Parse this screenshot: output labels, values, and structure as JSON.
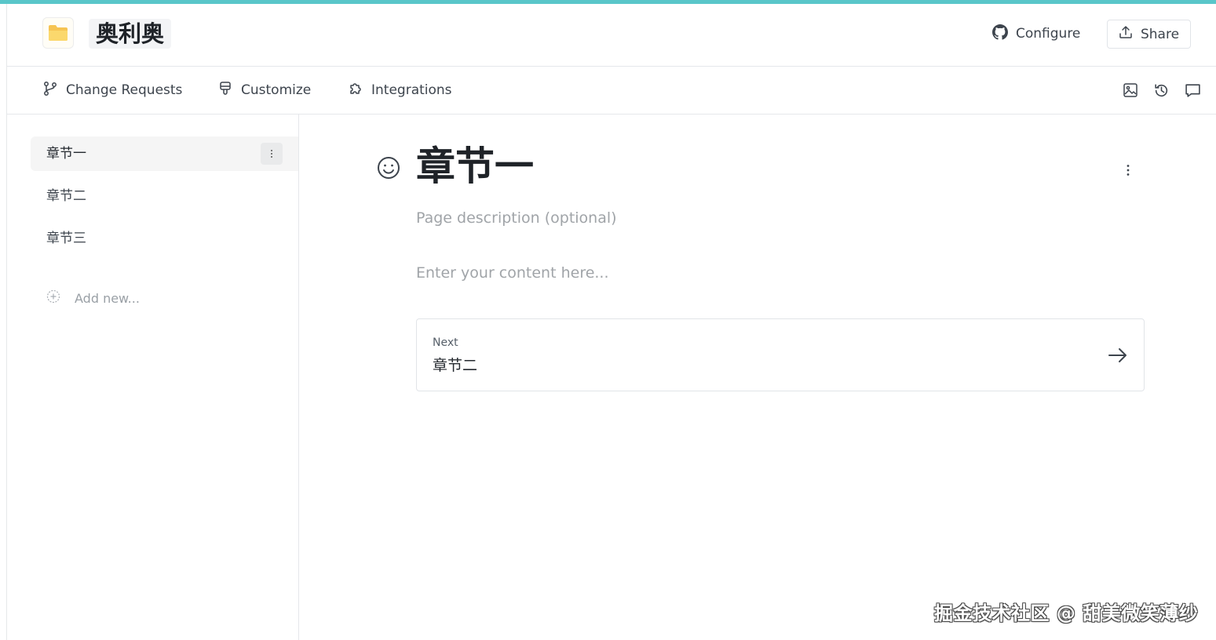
{
  "header": {
    "space_icon": "folder-icon",
    "space_title": "奥利奥",
    "configure_label": "Configure",
    "configure_icon": "github-icon",
    "share_label": "Share",
    "share_icon": "upload-icon"
  },
  "toolbar": {
    "tabs": [
      {
        "label": "Change Requests",
        "icon": "branch-icon"
      },
      {
        "label": "Customize",
        "icon": "paint-brush-icon"
      },
      {
        "label": "Integrations",
        "icon": "puzzle-icon"
      }
    ],
    "right_icons": [
      "image-icon",
      "history-icon",
      "comment-icon"
    ]
  },
  "sidebar": {
    "items": [
      {
        "label": "章节一",
        "active": true
      },
      {
        "label": "章节二",
        "active": false
      },
      {
        "label": "章节三",
        "active": false
      }
    ],
    "add_new_label": "Add new..."
  },
  "main": {
    "title": "章节一",
    "description_placeholder": "Page description (optional)",
    "content_placeholder": "Enter your content here...",
    "next": {
      "label": "Next",
      "title": "章节二"
    }
  },
  "watermark": "掘金技术社区 @ 甜美微笑薄纱",
  "colors": {
    "accent_bar": "#59c6c9",
    "active_item_bg": "#f5f5f5"
  }
}
